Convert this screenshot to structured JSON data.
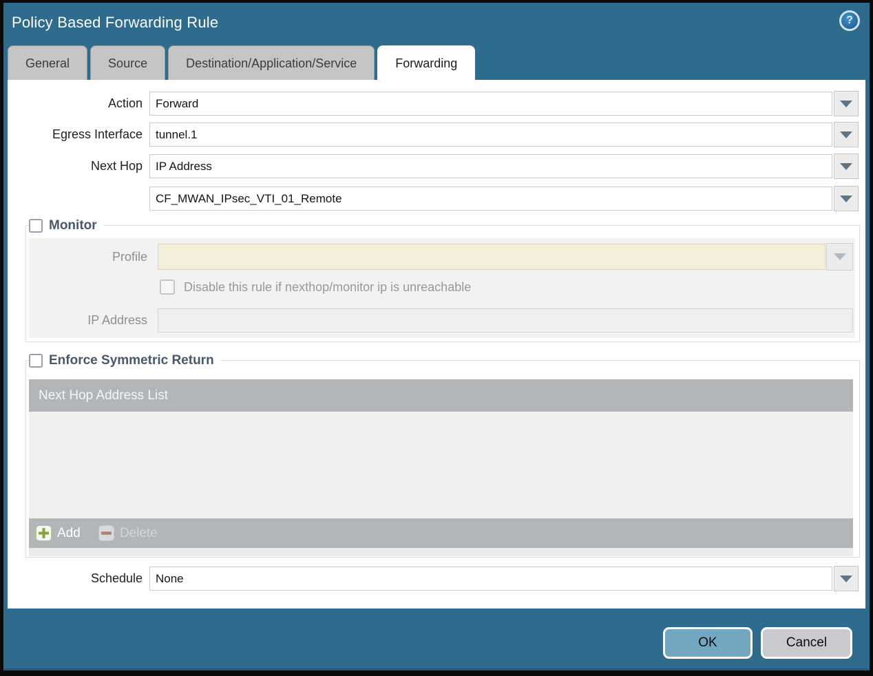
{
  "window": {
    "title": "Policy Based Forwarding Rule"
  },
  "icons": {
    "help_glyph": "?"
  },
  "tabs": [
    {
      "label": "General"
    },
    {
      "label": "Source"
    },
    {
      "label": "Destination/Application/Service"
    },
    {
      "label": "Forwarding"
    }
  ],
  "form": {
    "action": {
      "label": "Action",
      "value": "Forward"
    },
    "egress_interface": {
      "label": "Egress Interface",
      "value": "tunnel.1"
    },
    "next_hop": {
      "label": "Next Hop",
      "value": "IP Address"
    },
    "next_hop_address": {
      "value": "CF_MWAN_IPsec_VTI_01_Remote"
    },
    "schedule": {
      "label": "Schedule",
      "value": "None"
    }
  },
  "monitor": {
    "legend": "Monitor",
    "checked": false,
    "profile": {
      "label": "Profile",
      "value": ""
    },
    "disable_rule": {
      "label": "Disable this rule if nexthop/monitor ip is unreachable",
      "checked": false
    },
    "ip_address": {
      "label": "IP Address",
      "value": ""
    }
  },
  "symmetric_return": {
    "legend": "Enforce Symmetric Return",
    "checked": false,
    "table": {
      "header": "Next Hop Address List",
      "rows": []
    },
    "add_label": "Add",
    "delete_label": "Delete"
  },
  "footer": {
    "ok": "OK",
    "cancel": "Cancel"
  },
  "colors": {
    "chrome_teal": "#2e6b8d",
    "tab_inactive": "#c5c5c5",
    "ok_button": "#73a6c0",
    "cancel_button": "#c9cacd",
    "add_green": "#8aa23f",
    "delete_red": "#b08270",
    "disabled_field_beige": "#f5eedb",
    "table_gray": "#b3b6b9"
  }
}
